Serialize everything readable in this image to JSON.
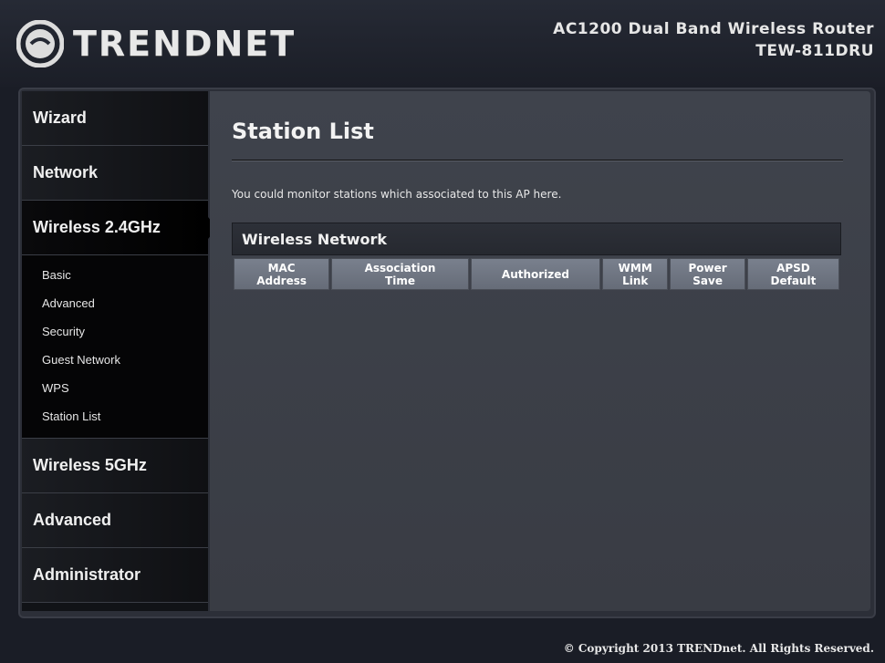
{
  "brand": {
    "name": "TRENDNET",
    "product_line": "AC1200 Dual Band Wireless Router",
    "model": "TEW-811DRU"
  },
  "sidebar": {
    "sections": [
      {
        "label": "Wizard"
      },
      {
        "label": "Network"
      },
      {
        "label": "Wireless 2.4GHz",
        "active": true,
        "items": [
          {
            "label": "Basic"
          },
          {
            "label": "Advanced"
          },
          {
            "label": "Security"
          },
          {
            "label": "Guest Network"
          },
          {
            "label": "WPS"
          },
          {
            "label": "Station List"
          }
        ]
      },
      {
        "label": "Wireless 5GHz"
      },
      {
        "label": "Advanced"
      },
      {
        "label": "Administrator"
      }
    ]
  },
  "main": {
    "title": "Station List",
    "description": "You could monitor stations which associated to this AP here.",
    "section_title": "Wireless Network",
    "table": {
      "columns": [
        [
          "MAC",
          "Address"
        ],
        [
          "Association",
          "Time"
        ],
        [
          "Authorized",
          ""
        ],
        [
          "WMM",
          "Link"
        ],
        [
          "Power",
          "Save"
        ],
        [
          "APSD",
          "Default"
        ]
      ],
      "rows": []
    }
  },
  "footer": {
    "copyright": "© Copyright 2013 TRENDnet. All Rights Reserved."
  }
}
